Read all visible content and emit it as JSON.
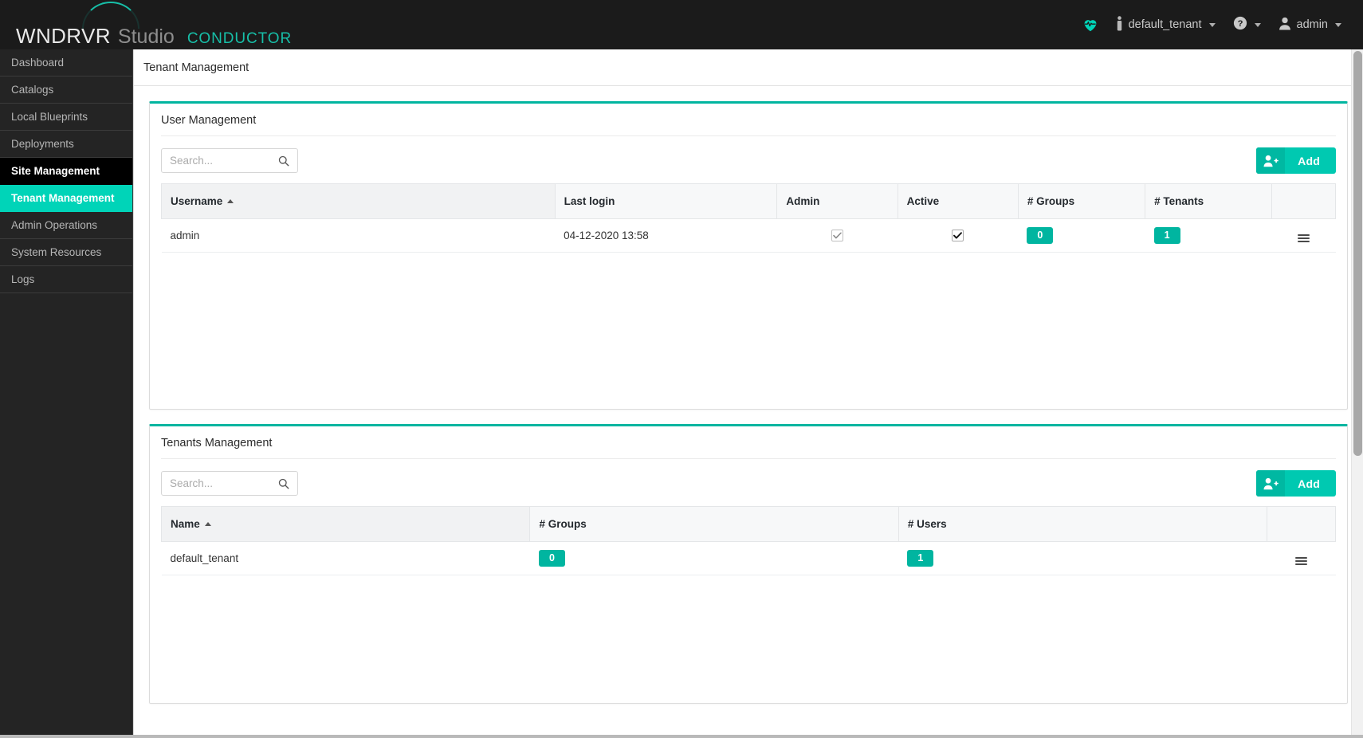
{
  "brand": {
    "name_primary": "WNDRVR",
    "name_secondary": "Studio",
    "product": "CONDUCTOR",
    "accent": "#17bfa8"
  },
  "header": {
    "health_icon": "heart-pulse-icon",
    "tenant_icon": "person-standing-icon",
    "tenant_label": "default_tenant",
    "help_icon": "question-circle-icon",
    "user_icon": "user-avatar-icon",
    "user_label": "admin"
  },
  "sidebar": {
    "items": [
      {
        "label": "Dashboard",
        "state": "normal"
      },
      {
        "label": "Catalogs",
        "state": "normal"
      },
      {
        "label": "Local Blueprints",
        "state": "normal"
      },
      {
        "label": "Deployments",
        "state": "normal"
      },
      {
        "label": "Site Management",
        "state": "parent-active"
      },
      {
        "label": "Tenant Management",
        "state": "active"
      },
      {
        "label": "Admin Operations",
        "state": "normal"
      },
      {
        "label": "System Resources",
        "state": "normal"
      },
      {
        "label": "Logs",
        "state": "normal"
      }
    ]
  },
  "page": {
    "title": "Tenant Management"
  },
  "colors": {
    "accent_teal": "#00d4b8",
    "panel_border_teal": "#00b5a0",
    "badge_teal": "#00b5a0",
    "button_teal": "#00c9b1",
    "sidebar_bg": "#242424",
    "header_bg": "#1b1b1b"
  },
  "user_management": {
    "panel_title": "User Management",
    "search": {
      "value": "",
      "placeholder": "Search...",
      "icon": "search-icon"
    },
    "add_button": {
      "label": "Add",
      "icon": "add-user-icon"
    },
    "columns": [
      {
        "key": "username",
        "label": "Username",
        "align": "left",
        "sort": "asc",
        "width": "31%"
      },
      {
        "key": "last_login",
        "label": "Last login",
        "align": "left",
        "sort": "none",
        "width": "17.5%"
      },
      {
        "key": "admin",
        "label": "Admin",
        "align": "left",
        "sort": "none",
        "width": "9.5%"
      },
      {
        "key": "active",
        "label": "Active",
        "align": "left",
        "sort": "none",
        "width": "9.5%"
      },
      {
        "key": "groups",
        "label": "# Groups",
        "align": "left",
        "sort": "none",
        "width": "10%"
      },
      {
        "key": "tenants",
        "label": "# Tenants",
        "align": "left",
        "sort": "none",
        "width": "10%"
      },
      {
        "key": "actions",
        "label": "",
        "align": "center",
        "sort": "none",
        "width": "5%"
      }
    ],
    "rows": [
      {
        "username": "admin",
        "last_login": "04-12-2020 13:58",
        "admin_checked": true,
        "admin_disabled": true,
        "active_checked": true,
        "active_disabled": false,
        "groups": "0",
        "tenants": "1",
        "actions_icon": "row-menu-icon"
      }
    ]
  },
  "tenants_management": {
    "panel_title": "Tenants Management",
    "search": {
      "value": "",
      "placeholder": "Search...",
      "icon": "search-icon"
    },
    "add_button": {
      "label": "Add",
      "icon": "add-user-icon"
    },
    "columns": [
      {
        "key": "name",
        "label": "Name",
        "align": "left",
        "sort": "asc",
        "width": "27%"
      },
      {
        "key": "groups",
        "label": "# Groups",
        "align": "left",
        "sort": "none",
        "width": "27%"
      },
      {
        "key": "users",
        "label": "# Users",
        "align": "left",
        "sort": "none",
        "width": "27%"
      },
      {
        "key": "actions",
        "label": "",
        "align": "center",
        "sort": "none",
        "width": "5%"
      }
    ],
    "rows": [
      {
        "name": "default_tenant",
        "groups": "0",
        "users": "1",
        "actions_icon": "row-menu-icon"
      }
    ]
  },
  "scrollbar": {
    "vertical_thumb_name": "vertical-scrollbar-thumb"
  }
}
